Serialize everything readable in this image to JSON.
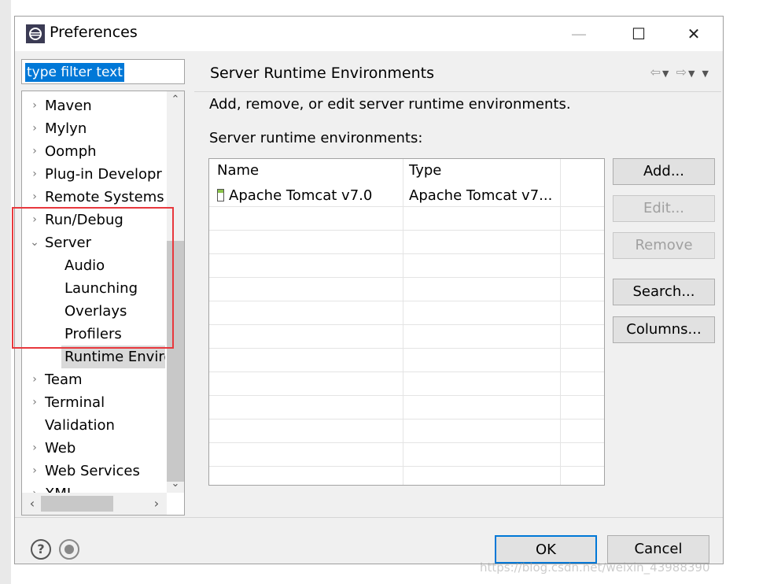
{
  "window": {
    "title": "Preferences",
    "icon": "eclipse-icon"
  },
  "filter": {
    "placeholder": "type filter text",
    "value": "type filter text"
  },
  "tree": {
    "items": [
      {
        "label": "Maven",
        "expander": "›"
      },
      {
        "label": "Mylyn",
        "expander": "›"
      },
      {
        "label": "Oomph",
        "expander": "›"
      },
      {
        "label": "Plug-in Developr",
        "expander": "›"
      },
      {
        "label": "Remote Systems",
        "expander": "›"
      },
      {
        "label": "Run/Debug",
        "expander": "›"
      },
      {
        "label": "Server",
        "expander": "⌄"
      },
      {
        "label": "Audio",
        "expander": ""
      },
      {
        "label": "Launching",
        "expander": ""
      },
      {
        "label": "Overlays",
        "expander": ""
      },
      {
        "label": "Profilers",
        "expander": ""
      },
      {
        "label": "Runtime Enviro",
        "expander": ""
      },
      {
        "label": "Team",
        "expander": "›"
      },
      {
        "label": "Terminal",
        "expander": "›"
      },
      {
        "label": "Validation",
        "expander": ""
      },
      {
        "label": "Web",
        "expander": "›"
      },
      {
        "label": "Web Services",
        "expander": "›"
      },
      {
        "label": "XML",
        "expander": "›"
      }
    ],
    "selected": "Runtime Enviro"
  },
  "page": {
    "title": "Server Runtime Environments",
    "description": "Add, remove, or edit server runtime environments.",
    "list_label": "Server runtime environments:",
    "columns": [
      "Name",
      "Type"
    ],
    "rows": [
      {
        "name": "Apache Tomcat v7.0",
        "type": "Apache Tomcat v7..."
      }
    ]
  },
  "buttons": {
    "add": "Add...",
    "edit": "Edit...",
    "remove": "Remove",
    "search": "Search...",
    "columns": "Columns..."
  },
  "footer": {
    "ok": "OK",
    "cancel": "Cancel"
  },
  "watermark": "https://blog.csdn.net/weixin_43988390",
  "colors": {
    "selection": "#0078d7",
    "highlight_box": "#e8383d"
  }
}
